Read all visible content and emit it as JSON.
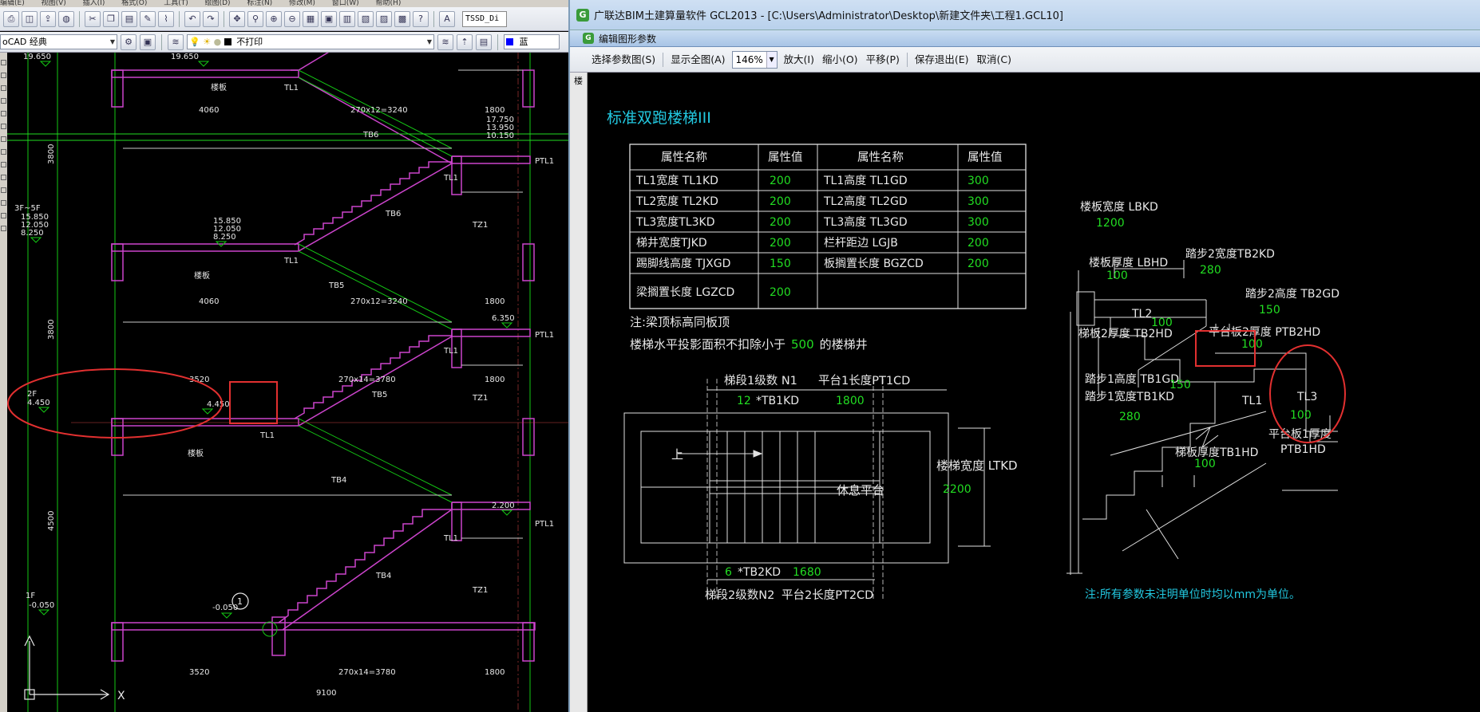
{
  "cad": {
    "menubar": [
      "编辑(E)",
      "视图(V)",
      "插入(I)",
      "格式(O)",
      "工具(T)",
      "绘图(D)",
      "标注(N)",
      "修改(M)",
      "窗口(W)",
      "帮助(H)"
    ],
    "style_box": "TSSD_Di",
    "workspace": "oCAD 经典",
    "layer_state": "不打印",
    "color_value": "蓝",
    "drawing": {
      "elevations": {
        "e19650": "19.650",
        "e15850": "15.850",
        "e12050": "12.050",
        "e8250": "8.250",
        "e6350": "6.350",
        "e4450": "4.450",
        "e2200": "2.200",
        "e0050": "-0.050",
        "e17750": "17.750",
        "e13950": "13.950",
        "e10150": "10.150"
      },
      "floor_labels": {
        "f3_5": "3F~5F",
        "f2": "2F",
        "f1": "1F"
      },
      "dims": {
        "d4060": "4060",
        "d3240": "270x12=3240",
        "d1800": "1800",
        "d3520": "3520",
        "d3780": "270x14=3780",
        "d9100": "9100",
        "d3800": "3800",
        "d4500": "4500"
      },
      "tags": {
        "tl1": "TL1",
        "ptl1": "PTL1",
        "tz1": "TZ1",
        "tb6": "TB6",
        "tb5": "TB5",
        "tb4": "TB4",
        "tb6b": "TB6",
        "tb5b": "TB5",
        "landing": "楼板",
        "detail_no": "1"
      }
    }
  },
  "gcl": {
    "window_title": "广联达BIM土建算量软件 GCL2013 - [C:\\Users\\Administrator\\Desktop\\新建文件夹\\工程1.GCL10]",
    "dialog_title": "编辑图形参数",
    "sidebar_label": "楼",
    "toolbar": {
      "select_param": "选择参数图(S)",
      "show_all": "显示全图(A)",
      "zoom_value": "146%",
      "zoom_in": "放大(I)",
      "zoom_out": "缩小(O)",
      "pan": "平移(P)",
      "save_exit": "保存退出(E)",
      "cancel": "取消(C)"
    },
    "drawing": {
      "title": "标准双跑楼梯III",
      "table": {
        "headers": [
          "属性名称",
          "属性值",
          "属性名称",
          "属性值"
        ],
        "rows": [
          [
            "TL1宽度 TL1KD",
            "200",
            "TL1高度 TL1GD",
            "300"
          ],
          [
            "TL2宽度 TL2KD",
            "200",
            "TL2高度 TL2GD",
            "300"
          ],
          [
            "TL3宽度TL3KD",
            "200",
            "TL3高度 TL3GD",
            "300"
          ],
          [
            "梯井宽度TJKD",
            "200",
            "栏杆距边 LGJB",
            "200"
          ],
          [
            "踢脚线高度 TJXGD",
            "150",
            "板搁置长度 BGZCD",
            "200"
          ],
          [
            "梁搁置长度 LGZCD",
            "200",
            "",
            ""
          ]
        ]
      },
      "note1": "注:梁顶标高同板顶",
      "note2_prefix": "楼梯水平投影面积不扣除小于",
      "note2_value": "500",
      "note2_suffix": "的楼梯井",
      "plan": {
        "n1_label": "梯段1级数 N1",
        "n1_value": "12",
        "tb1kd": "*TB1KD",
        "pt1cd_label": "平台1长度PT1CD",
        "pt1cd_value": "1800",
        "up": "上",
        "rest": "休息平台",
        "ltkd_label": "楼梯宽度 LTKD",
        "ltkd_value": "2200",
        "n2_value": "6",
        "tb2kd": "*TB2KD",
        "pt2cd_value": "1680",
        "n2_label": "梯段2级数N2",
        "pt2cd_label": "平台2长度PT2CD"
      },
      "section": {
        "lbkd_label": "楼板宽度 LBKD",
        "lbkd_value": "1200",
        "lbhd_label": "楼板厚度 LBHD",
        "lbhd_value": "100",
        "tb2kd_label": "踏步2宽度TB2KD",
        "tb2kd_value": "280",
        "tb2gd_label": "踏步2高度 TB2GD",
        "tb2gd_value": "150",
        "tl2": "TL2",
        "tb2hd_label": "梯板2厚度 TB2HD",
        "tb2hd_value": "100",
        "ptb2hd_label": "平台板2厚度 PTB2HD",
        "ptb2hd_value": "100",
        "tb1gd_label": "踏步1高度 TB1GD",
        "tb1gd_value": "150",
        "tb1kd_label": "踏步1宽度TB1KD",
        "tb1kd_value": "280",
        "tl1": "TL1",
        "tl3": "TL3",
        "tl3_value": "100",
        "tb1hd_label": "梯板厚度TB1HD",
        "tb1hd_value": "100",
        "ptb1hd_label": "平台板1厚度",
        "ptb1hd_code": "PTB1HD"
      },
      "footnote": "注:所有参数未注明单位时均以mm为单位。"
    }
  }
}
